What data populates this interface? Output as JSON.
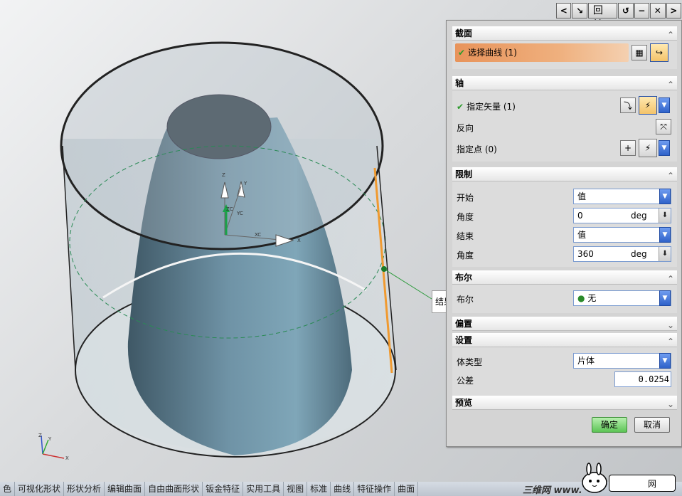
{
  "dialog": {
    "title": "回转",
    "sections": {
      "section": {
        "title": "截面",
        "select_curve": "选择曲线 (1)"
      },
      "axis": {
        "title": "轴",
        "vector": "指定矢量 (1)",
        "reverse": "反向",
        "point": "指定点 (0)"
      },
      "limits": {
        "title": "限制",
        "start_label": "开始",
        "start_value": "值",
        "start_angle_label": "角度",
        "start_angle": "0",
        "start_unit": "deg",
        "end_label": "结束",
        "end_value": "值",
        "end_angle_label": "角度",
        "end_angle": "360",
        "end_unit": "deg"
      },
      "boolean": {
        "title": "布尔",
        "label": "布尔",
        "value": "无"
      },
      "offset": {
        "title": "偏置"
      },
      "settings": {
        "title": "设置",
        "body_type_label": "体类型",
        "body_type": "片体",
        "tolerance_label": "公差",
        "tolerance": "0.0254"
      },
      "preview": {
        "title": "预览"
      }
    },
    "ok_label": "确定",
    "cancel_label": "取消"
  },
  "viewport": {
    "result_tag": "结果",
    "triad": {
      "z": "Z",
      "y": "Y",
      "xc": "XC",
      "yc": "YC",
      "x": "X",
      "zc": "ZC"
    },
    "mini_triad": {
      "z": "Z",
      "y": "Y",
      "x": "X"
    }
  },
  "status_tabs": [
    "色",
    "可视化形状",
    "形状分析",
    "编辑曲面",
    "自由曲面形状",
    "钣金特征",
    "实用工具",
    "视图",
    "标准",
    "曲线",
    "特征操作",
    "曲面"
  ],
  "watermark": {
    "text": "三维网 www.",
    "box_text": "网"
  },
  "colors": {
    "accent_orange": "#e8935a",
    "ok_green": "#5cc455",
    "highlight_red": "#d81e1e"
  }
}
